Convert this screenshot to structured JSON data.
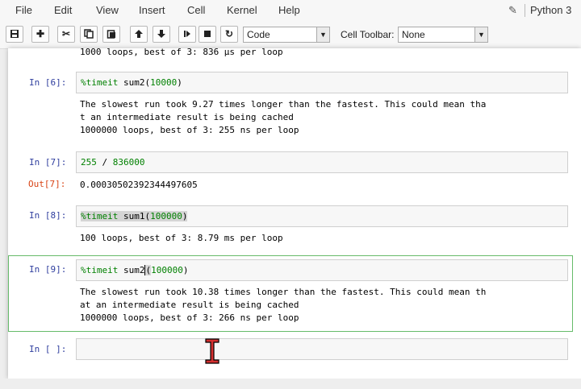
{
  "menubar": {
    "items": [
      "File",
      "Edit",
      "View",
      "Insert",
      "Cell",
      "Kernel",
      "Help"
    ],
    "kernel_name": "Python 3"
  },
  "toolbar": {
    "buttons": [
      "save-icon",
      "plus-icon",
      "cut-icon",
      "copy-icon",
      "paste-icon",
      "arrow-up-icon",
      "arrow-down-icon",
      "skip-next-icon",
      "stop-icon",
      "refresh-icon"
    ],
    "cell_type": "Code",
    "cell_toolbar_label": "Cell Toolbar:",
    "cell_toolbar_value": "None"
  },
  "cells": {
    "prev_output": "1000 loops, best of 3: 836 µs per loop",
    "c6": {
      "prompt": "In [6]:",
      "code_magic": "%timeit",
      "code_call": " sum2(",
      "code_arg": "10000",
      "code_close": ")",
      "out1": "The slowest run took 9.27 times longer than the fastest. This could mean tha",
      "out2": "t an intermediate result is being cached",
      "out3": "1000000 loops, best of 3: 255 ns per loop"
    },
    "c7": {
      "prompt": "In [7]:",
      "code_a": "255",
      "code_op": " / ",
      "code_b": "836000",
      "out_prompt": "Out[7]:",
      "out": "0.00030502392344497605"
    },
    "c8": {
      "prompt": "In [8]:",
      "code_magic": "%timeit",
      "code_call": " sum1(",
      "code_arg": "100000",
      "code_close": ")",
      "out": "100 loops, best of 3: 8.79 ms per loop"
    },
    "c9": {
      "prompt": "In [9]:",
      "code_magic": "%timeit",
      "code_call": " sum2",
      "code_open": "(",
      "code_arg": "100000",
      "code_close": ")",
      "out1": "The slowest run took 10.38 times longer than the fastest. This could mean th",
      "out2": "at an intermediate result is being cached",
      "out3": "1000000 loops, best of 3: 266 ns per loop"
    },
    "empty": {
      "prompt": "In [ ]:"
    }
  },
  "colors": {
    "prompt_in": "#303f9f",
    "prompt_out": "#d84315",
    "selected_border": "#66bb6a",
    "keyword_green": "#008000"
  }
}
